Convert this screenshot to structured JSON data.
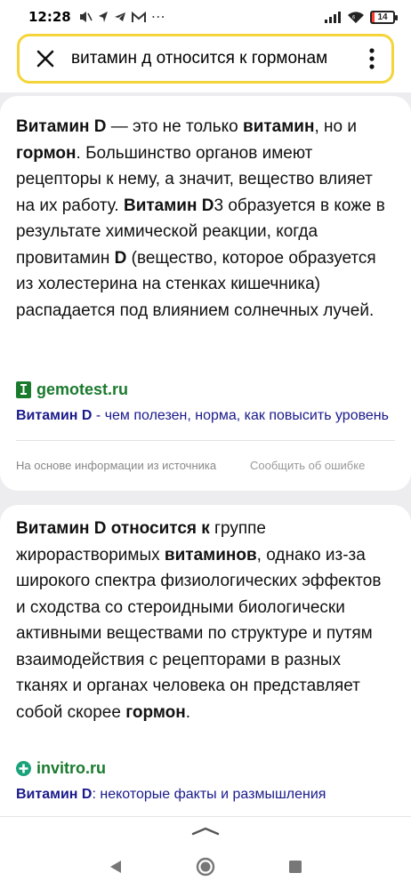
{
  "status_bar": {
    "time": "12:28",
    "battery_level": "14",
    "battery_color": "#ff3b30"
  },
  "search": {
    "query": "витамин д относится к гормонам",
    "close_icon": "close-icon",
    "menu_icon": "more-vertical-icon"
  },
  "card1": {
    "answer_parts": [
      {
        "b": true,
        "t": "Витамин D"
      },
      {
        "b": false,
        "t": " — это не только "
      },
      {
        "b": true,
        "t": "витамин"
      },
      {
        "b": false,
        "t": ", но и "
      },
      {
        "b": true,
        "t": "гормон"
      },
      {
        "b": false,
        "t": ". Большинство органов имеют рецепторы к нему, а значит, вещество влияет на их работу. "
      },
      {
        "b": true,
        "t": "Витамин D"
      },
      {
        "b": false,
        "t": "3 образуется в коже в результате химической реакции, когда провитамин "
      },
      {
        "b": true,
        "t": "D"
      },
      {
        "b": false,
        "t": " (вещество, которое образуется из холестерина на стенках кишечника) распадается под влиянием солнечных лучей."
      }
    ],
    "source_domain": "gemotest.ru",
    "source_link_bold": "Витамин D",
    "source_link_rest": " - чем полезен, норма, как повысить уровень",
    "footer_note": "На основе информации из источника",
    "report_link": "Сообщить об ошибке"
  },
  "card2": {
    "answer_parts": [
      {
        "b": true,
        "t": "Витамин D относится к"
      },
      {
        "b": false,
        "t": " группе жирорастворимых "
      },
      {
        "b": true,
        "t": "витаминов"
      },
      {
        "b": false,
        "t": ", однако из-за широкого спектра физиологических эффектов и сходства со стероидными биологически активными веществами по структуре и путям взаимодействия с рецепторами в разных тканях и органах человека он представляет собой скорее "
      },
      {
        "b": true,
        "t": "гормон"
      },
      {
        "b": false,
        "t": "."
      }
    ],
    "source_domain": "invitro.ru",
    "source_link_bold": "Витамин D",
    "source_link_rest": ": некоторые факты и размышления"
  },
  "colors": {
    "search_border": "#f5d43a",
    "source_green": "#1a7a2e",
    "link_blue": "#1a1a8c"
  }
}
